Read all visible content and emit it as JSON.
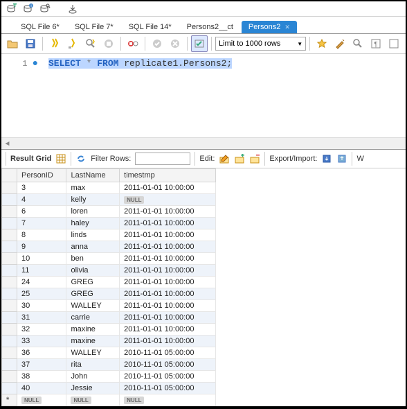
{
  "top_icons": [
    "db-add",
    "db-info",
    "db-search",
    "commit"
  ],
  "tabs": [
    {
      "label": "SQL File 6*",
      "active": false
    },
    {
      "label": "SQL File 7*",
      "active": false
    },
    {
      "label": "SQL File 14*",
      "active": false
    },
    {
      "label": "Persons2__ct",
      "active": false
    },
    {
      "label": "Persons2",
      "active": true
    }
  ],
  "toolbar": {
    "limit_label": "Limit to 1000 rows"
  },
  "editor": {
    "line_no": "1",
    "query_kw1": "SELECT",
    "query_op": " * ",
    "query_kw2": "FROM",
    "query_ident": " replicate1.Persons2;"
  },
  "result_toolbar": {
    "grid_label": "Result Grid",
    "filter_label": "Filter Rows:",
    "filter_value": "",
    "edit_label": "Edit:",
    "export_label": "Export/Import:",
    "wrap_label": "W"
  },
  "columns": [
    "PersonID",
    "LastName",
    "timestmp"
  ],
  "rows": [
    {
      "PersonID": "3",
      "LastName": "max",
      "timestmp": "2011-01-01 10:00:00"
    },
    {
      "PersonID": "4",
      "LastName": "kelly",
      "timestmp": null
    },
    {
      "PersonID": "6",
      "LastName": "loren",
      "timestmp": "2011-01-01 10:00:00"
    },
    {
      "PersonID": "7",
      "LastName": "haley",
      "timestmp": "2011-01-01 10:00:00"
    },
    {
      "PersonID": "8",
      "LastName": "linds",
      "timestmp": "2011-01-01 10:00:00"
    },
    {
      "PersonID": "9",
      "LastName": "anna",
      "timestmp": "2011-01-01 10:00:00"
    },
    {
      "PersonID": "10",
      "LastName": "ben",
      "timestmp": "2011-01-01 10:00:00"
    },
    {
      "PersonID": "11",
      "LastName": "olivia",
      "timestmp": "2011-01-01 10:00:00"
    },
    {
      "PersonID": "24",
      "LastName": "GREG",
      "timestmp": "2011-01-01 10:00:00"
    },
    {
      "PersonID": "25",
      "LastName": "GREG",
      "timestmp": "2011-01-01 10:00:00"
    },
    {
      "PersonID": "30",
      "LastName": "WALLEY",
      "timestmp": "2011-01-01 10:00:00"
    },
    {
      "PersonID": "31",
      "LastName": "carrie",
      "timestmp": "2011-01-01 10:00:00"
    },
    {
      "PersonID": "32",
      "LastName": "maxine",
      "timestmp": "2011-01-01 10:00:00"
    },
    {
      "PersonID": "33",
      "LastName": "maxine",
      "timestmp": "2011-01-01 10:00:00"
    },
    {
      "PersonID": "36",
      "LastName": "WALLEY",
      "timestmp": "2010-11-01 05:00:00"
    },
    {
      "PersonID": "37",
      "LastName": "rita",
      "timestmp": "2010-11-01 05:00:00"
    },
    {
      "PersonID": "38",
      "LastName": "John",
      "timestmp": "2010-11-01 05:00:00"
    },
    {
      "PersonID": "40",
      "LastName": "Jessie",
      "timestmp": "2010-11-01 05:00:00"
    }
  ],
  "null_label": "NULL"
}
